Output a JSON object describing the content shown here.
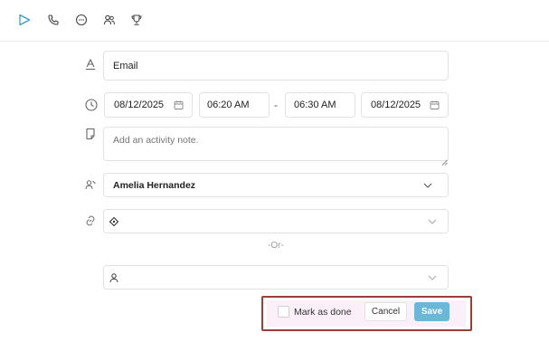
{
  "tabs": [
    {
      "icon": "send-icon",
      "active": true
    },
    {
      "icon": "phone-icon",
      "active": false
    },
    {
      "icon": "chat-icon",
      "active": false
    },
    {
      "icon": "people-icon",
      "active": false
    },
    {
      "icon": "trophy-icon",
      "active": false
    }
  ],
  "activity": {
    "type_value": "Email",
    "start_date": "08/12/2025",
    "start_time": "06:20 AM",
    "separator": "-",
    "end_time": "06:30 AM",
    "end_date": "08/12/2025",
    "note_placeholder": "Add an activity note.",
    "assignee": "Amelia Hernandez",
    "deal_value": "",
    "or_label": "-Or-",
    "contact_value": ""
  },
  "footer": {
    "mark_done_label": "Mark as done",
    "mark_done_checked": false,
    "cancel_label": "Cancel",
    "save_label": "Save"
  },
  "colors": {
    "accent": "#6ab7d8",
    "active_tab": "#3a9bd0",
    "highlight_border": "#9c4036"
  }
}
